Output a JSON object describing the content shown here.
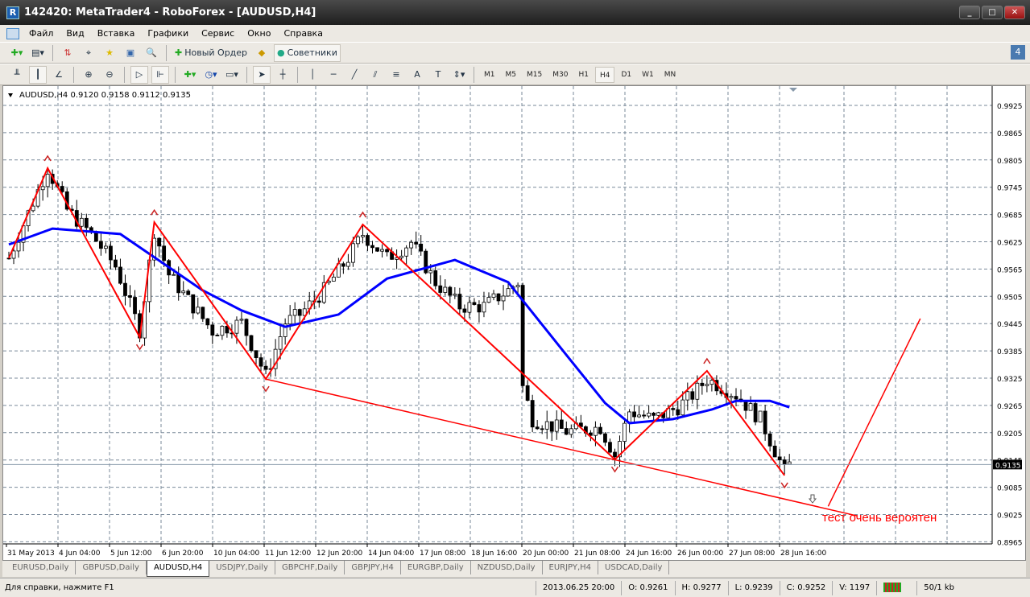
{
  "window": {
    "title": "142420: MetaTrader4 - RoboForex - [AUDUSD,H4]",
    "icon": "mt4-logo"
  },
  "menu": [
    "Файл",
    "Вид",
    "Вставка",
    "Графики",
    "Сервис",
    "Окно",
    "Справка"
  ],
  "toolbar1": {
    "new_order": "Новый Ордер",
    "advisors": "Советники"
  },
  "toolbar2": {
    "drawing_labels": {
      "text": "A",
      "label": "T"
    },
    "timeframes": [
      "M1",
      "M5",
      "M15",
      "M30",
      "H1",
      "H4",
      "D1",
      "W1",
      "MN"
    ],
    "active_timeframe": "H4"
  },
  "chart": {
    "symbol_info": "AUDUSD,H4  0.9120 0.9158 0.9112 0.9135",
    "annotation": "тест очень вероятен",
    "current_price": "0.9135"
  },
  "chart_data": {
    "type": "candlestick",
    "symbol": "AUDUSD",
    "timeframe": "H4",
    "price_ticks": [
      "0.9925",
      "0.9865",
      "0.9805",
      "0.9745",
      "0.9685",
      "0.9625",
      "0.9565",
      "0.9505",
      "0.9445",
      "0.9385",
      "0.9325",
      "0.9265",
      "0.9205",
      "0.9145",
      "0.9085",
      "0.9025",
      "0.8965"
    ],
    "ylim": [
      0.8965,
      0.9925
    ],
    "time_ticks": [
      "31 May 2013",
      "4 Jun 04:00",
      "5 Jun 12:00",
      "6 Jun 20:00",
      "10 Jun 04:00",
      "11 Jun 12:00",
      "12 Jun 20:00",
      "14 Jun 04:00",
      "17 Jun 08:00",
      "18 Jun 16:00",
      "20 Jun 00:00",
      "21 Jun 08:00",
      "24 Jun 16:00",
      "26 Jun 00:00",
      "27 Jun 08:00",
      "28 Jun 16:00"
    ],
    "bar_count": 162,
    "price_path": [
      [
        0,
        0.9589
      ],
      [
        8,
        0.9787
      ],
      [
        12,
        0.9695
      ],
      [
        17,
        0.9642
      ],
      [
        22,
        0.9571
      ],
      [
        27,
        0.943
      ],
      [
        30,
        0.965
      ],
      [
        33,
        0.9553
      ],
      [
        38,
        0.9483
      ],
      [
        42,
        0.9429
      ],
      [
        48,
        0.9447
      ],
      [
        53,
        0.933
      ],
      [
        57,
        0.9447
      ],
      [
        60,
        0.9465
      ],
      [
        65,
        0.9518
      ],
      [
        70,
        0.9589
      ],
      [
        73,
        0.9642
      ],
      [
        78,
        0.9589
      ],
      [
        83,
        0.9624
      ],
      [
        88,
        0.9536
      ],
      [
        93,
        0.9483
      ],
      [
        98,
        0.9483
      ],
      [
        103,
        0.9518
      ],
      [
        105,
        0.9536
      ],
      [
        106,
        0.9306
      ],
      [
        108,
        0.9235
      ],
      [
        115,
        0.9208
      ],
      [
        122,
        0.9217
      ],
      [
        125,
        0.9155
      ],
      [
        128,
        0.9252
      ],
      [
        133,
        0.9235
      ],
      [
        138,
        0.9261
      ],
      [
        141,
        0.9288
      ],
      [
        144,
        0.9323
      ],
      [
        150,
        0.9288
      ],
      [
        155,
        0.9235
      ],
      [
        160,
        0.912
      ],
      [
        161,
        0.9135
      ]
    ],
    "moving_average": [
      [
        0,
        0.9619
      ],
      [
        9,
        0.9654
      ],
      [
        23,
        0.9642
      ],
      [
        40,
        0.9518
      ],
      [
        48,
        0.9474
      ],
      [
        57,
        0.9438
      ],
      [
        68,
        0.9465
      ],
      [
        78,
        0.9544
      ],
      [
        92,
        0.9585
      ],
      [
        103,
        0.9536
      ],
      [
        115,
        0.9376
      ],
      [
        123,
        0.927
      ],
      [
        128,
        0.9226
      ],
      [
        137,
        0.9235
      ],
      [
        145,
        0.9256
      ],
      [
        150,
        0.9275
      ],
      [
        157,
        0.9275
      ],
      [
        161,
        0.9261
      ]
    ],
    "zigzag": [
      [
        0,
        0.9589
      ],
      [
        8,
        0.9787
      ],
      [
        27,
        0.9415
      ],
      [
        30,
        0.9668
      ],
      [
        53,
        0.9323
      ],
      [
        73,
        0.9663
      ],
      [
        125,
        0.9146
      ],
      [
        144,
        0.9341
      ],
      [
        160,
        0.9111
      ]
    ],
    "trendline": [
      [
        53,
        0.9323
      ],
      [
        175,
        0.9022
      ]
    ],
    "forecast_line": [
      [
        169,
        0.9043
      ],
      [
        188,
        0.9456
      ]
    ],
    "colors": {
      "zigzag": "#ff0000",
      "ma": "#0000ff",
      "grid": "#7a8a9a"
    }
  },
  "tabs": [
    "EURUSD,Daily",
    "GBPUSD,Daily",
    "AUDUSD,H4",
    "USDJPY,Daily",
    "GBPCHF,Daily",
    "GBPJPY,H4",
    "EURGBP,Daily",
    "NZDUSD,Daily",
    "EURJPY,H4",
    "USDCAD,Daily"
  ],
  "active_tab": "AUDUSD,H4",
  "status": {
    "help": "Для справки, нажмите F1",
    "time": "2013.06.25 20:00",
    "open": "O: 0.9261",
    "high": "H: 0.9277",
    "low": "L: 0.9239",
    "close": "C: 0.9252",
    "volume": "V: 1197",
    "traffic": "50/1 kb"
  }
}
